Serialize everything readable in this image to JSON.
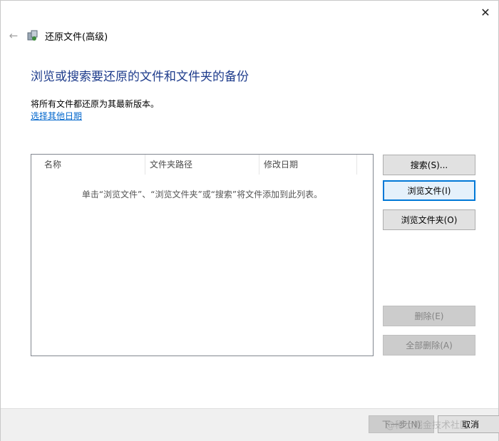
{
  "window": {
    "title": "还原文件(高级)",
    "close_icon": "close-icon",
    "back_icon": "back-arrow-icon"
  },
  "content": {
    "heading": "浏览或搜索要还原的文件和文件夹的备份",
    "description": "将所有文件都还原为其最新版本。",
    "choose_date_link": "选择其他日期"
  },
  "file_list": {
    "columns": [
      "名称",
      "文件夹路径",
      "修改日期"
    ],
    "empty_hint": "单击“浏览文件”、“浏览文件夹”或“搜索”将文件添加到此列表。"
  },
  "side_buttons": {
    "search": "搜索(S)...",
    "browse_files": "浏览文件(I)",
    "browse_folders": "浏览文件夹(O)",
    "remove": "删除(E)",
    "remove_all": "全部删除(A)"
  },
  "footer": {
    "next": "下一步(N)",
    "cancel": "取消"
  },
  "overlay": {
    "watermark": "@稀土掘金技术社区"
  },
  "colors": {
    "heading": "#1e3c8c",
    "link": "#0066cc",
    "focus_border": "#0078d7"
  }
}
